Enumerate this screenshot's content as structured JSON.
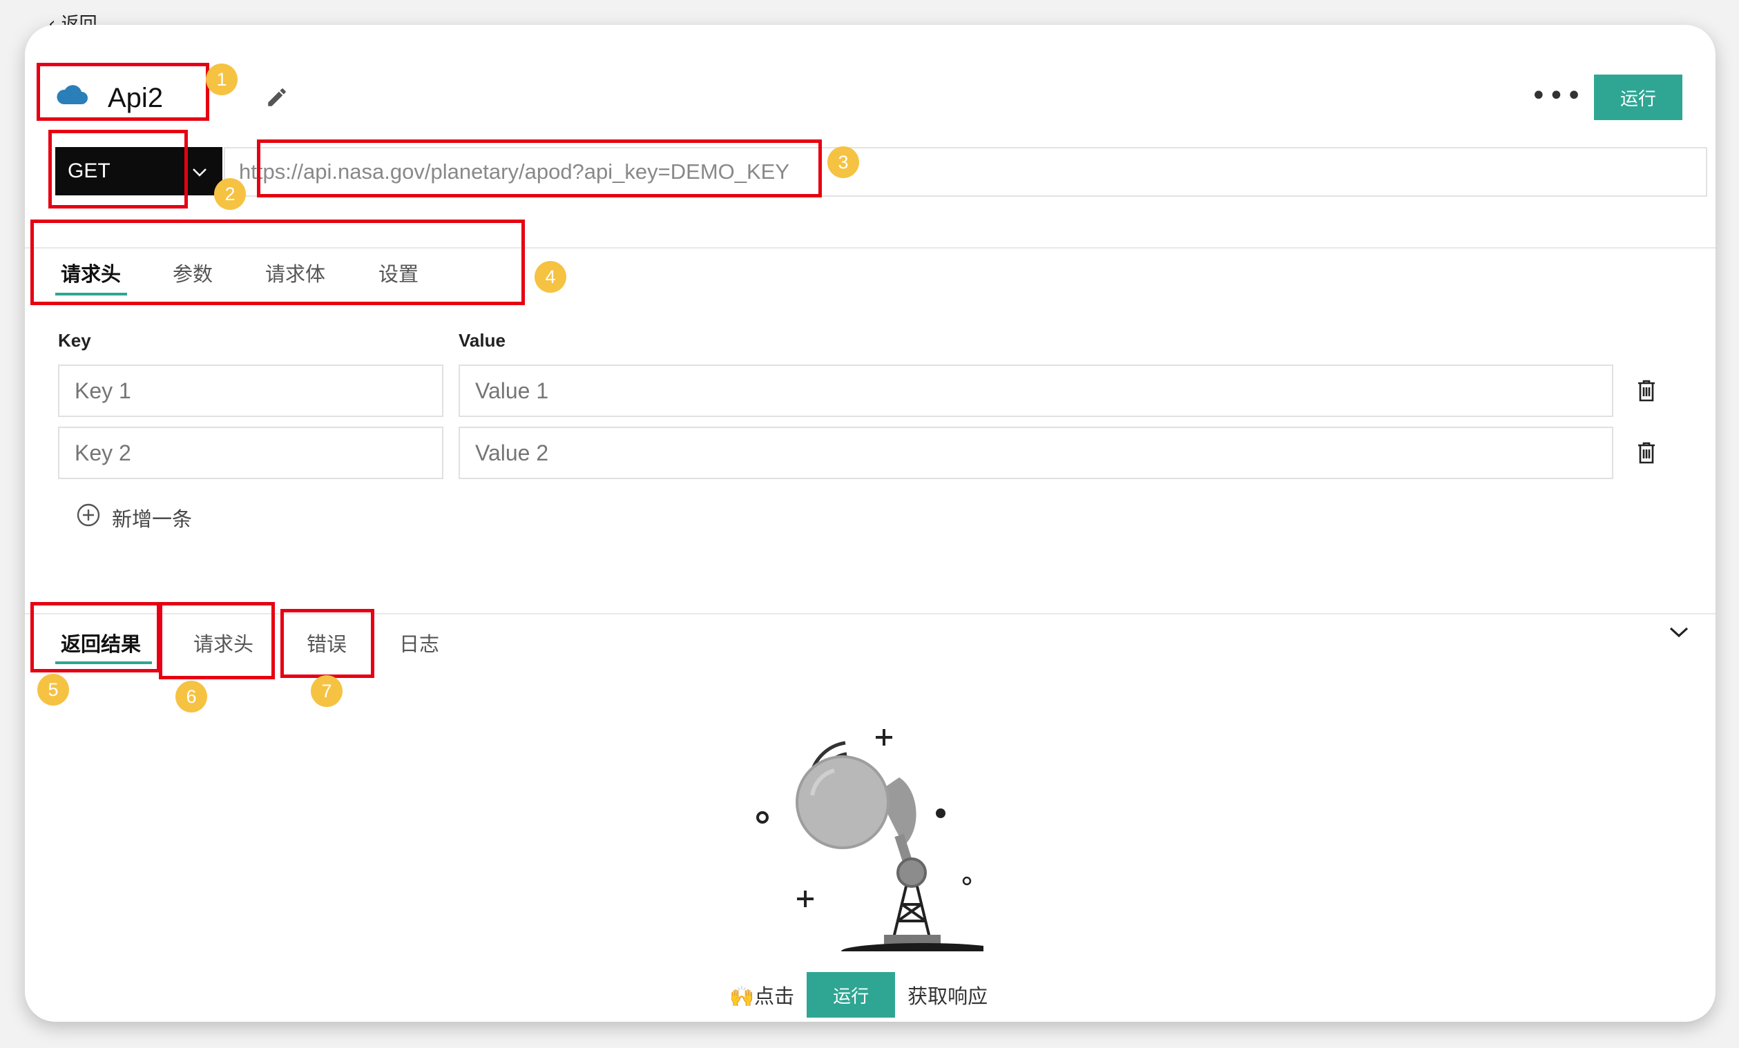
{
  "back_label": "返回",
  "api": {
    "title": "Api2"
  },
  "toolbar": {
    "more_label": "•••",
    "run_label": "运行"
  },
  "request": {
    "method": "GET",
    "url": "https://api.nasa.gov/planetary/apod?api_key=DEMO_KEY"
  },
  "request_tabs": [
    "请求头",
    "参数",
    "请求体",
    "设置"
  ],
  "headers": {
    "key_label": "Key",
    "value_label": "Value",
    "rows": [
      {
        "key_placeholder": "Key 1",
        "value_placeholder": "Value 1"
      },
      {
        "key_placeholder": "Key 2",
        "value_placeholder": "Value 2"
      }
    ],
    "add_label": "新增一条"
  },
  "response_tabs": [
    "返回结果",
    "请求头",
    "错误",
    "日志"
  ],
  "empty_state": {
    "prefix": "🙌点击",
    "run_label": "运行",
    "suffix": "获取响应"
  },
  "annotations": [
    "1",
    "2",
    "3",
    "4",
    "5",
    "6",
    "7"
  ],
  "colors": {
    "accent": "#2fa693",
    "annotation_box": "#e60012",
    "annotation_badge": "#f5c242",
    "method_bg": "#0c0c0c"
  },
  "icons": [
    "cloud-icon",
    "edit-icon",
    "chevron-down-icon",
    "trash-icon",
    "add-circle-icon",
    "satellite-dish-illustration"
  ]
}
